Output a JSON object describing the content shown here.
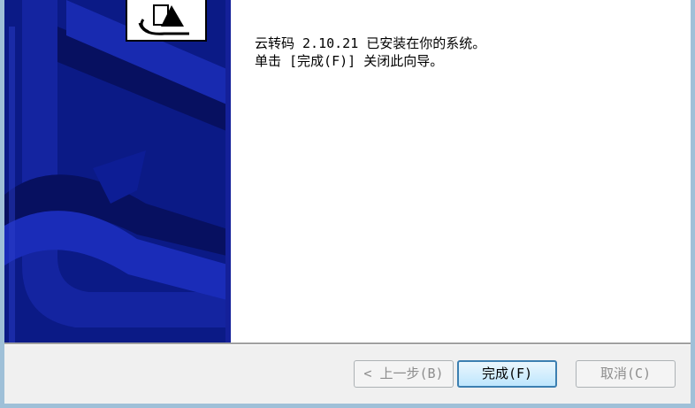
{
  "installer": {
    "message_line1": "云转码 2.10.21 已安装在你的系统。",
    "message_line2": "单击 [完成(F)] 关闭此向导。"
  },
  "buttons": {
    "back": "< 上一步(B)",
    "finish": "完成(F)",
    "cancel": "取消(C)"
  },
  "icons": {
    "side_banner": "installer-banner-art",
    "logo": "installer-logo-icon"
  },
  "colors": {
    "banner_blue": "#0b1a86",
    "default_button_border": "#3c7fb1"
  }
}
